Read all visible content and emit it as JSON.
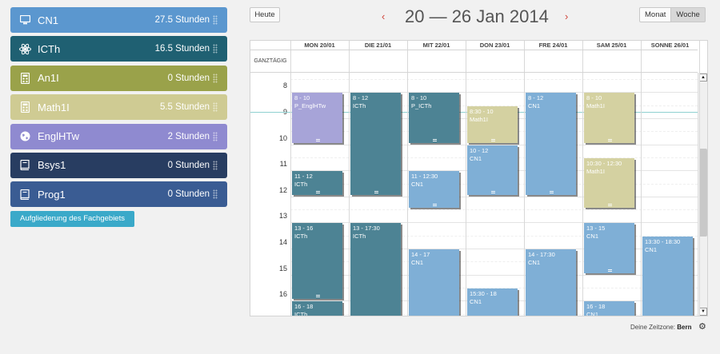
{
  "subjects": [
    {
      "name": "CN1",
      "hours": "27.5 Stunden",
      "color": "#5b97cf",
      "icon": "monitor-icon"
    },
    {
      "name": "ICTh",
      "hours": "16.5 Stunden",
      "color": "#1f6072",
      "icon": "atom-icon"
    },
    {
      "name": "An1I",
      "hours": "0 Stunden",
      "color": "#9aa24a",
      "icon": "calculator-icon"
    },
    {
      "name": "Math1I",
      "hours": "5.5 Stunden",
      "color": "#cfcb93",
      "icon": "calculator-icon"
    },
    {
      "name": "EnglHTw",
      "hours": "2 Stunden",
      "color": "#8f8ad0",
      "icon": "globe-icon"
    },
    {
      "name": "Bsys1",
      "hours": "0 Stunden",
      "color": "#283d61",
      "icon": "book-icon"
    },
    {
      "name": "Prog1",
      "hours": "0 Stunden",
      "color": "#3a5c93",
      "icon": "book-icon"
    }
  ],
  "breakdown_button": "Aufgliederung des Fachgebiets",
  "header": {
    "today": "Heute",
    "prev": "‹",
    "next": "›",
    "title": "20 — 26 Jan 2014",
    "views": [
      "Monat",
      "Woche"
    ],
    "active_view": "Woche"
  },
  "calendar": {
    "days": [
      "MON 20/01",
      "DIE 21/01",
      "MIT 22/01",
      "DON 23/01",
      "FRE 24/01",
      "SAM 25/01",
      "SONNE 26/01"
    ],
    "allday_label": "GANZTÄGIG",
    "hours": [
      "8",
      "9",
      "10",
      "11",
      "12",
      "13",
      "14",
      "15",
      "16"
    ],
    "now_hour": 8.75,
    "events": [
      {
        "day": 0,
        "start": 8,
        "end": 10,
        "time": "8 - 10",
        "title": "P_EnglHTw",
        "color": "purple"
      },
      {
        "day": 0,
        "start": 11,
        "end": 12,
        "time": "11 - 12",
        "title": "ICTh",
        "color": "teal"
      },
      {
        "day": 0,
        "start": 13,
        "end": 16,
        "time": "13 - 16",
        "title": "ICTh",
        "color": "teal"
      },
      {
        "day": 0,
        "start": 16,
        "end": 18,
        "time": "16 - 18",
        "title": "ICTh",
        "color": "teal"
      },
      {
        "day": 1,
        "start": 8,
        "end": 12,
        "time": "8 - 12",
        "title": "ICTh",
        "color": "teal"
      },
      {
        "day": 1,
        "start": 13,
        "end": 17.5,
        "time": "13 - 17:30",
        "title": "ICTh",
        "color": "teal"
      },
      {
        "day": 2,
        "start": 8,
        "end": 10,
        "time": "8 - 10",
        "title": "P_ICTh",
        "color": "teal"
      },
      {
        "day": 2,
        "start": 11,
        "end": 12.5,
        "time": "11 - 12:30",
        "title": "CN1",
        "color": "blue"
      },
      {
        "day": 2,
        "start": 14,
        "end": 17,
        "time": "14 - 17",
        "title": "CN1",
        "color": "blue"
      },
      {
        "day": 3,
        "start": 8.5,
        "end": 10,
        "time": "8:30 - 10",
        "title": "Math1I",
        "color": "khaki"
      },
      {
        "day": 3,
        "start": 10,
        "end": 12,
        "time": "10 - 12",
        "title": "CN1",
        "color": "blue"
      },
      {
        "day": 3,
        "start": 15.5,
        "end": 18,
        "time": "15:30 - 18",
        "title": "CN1",
        "color": "blue"
      },
      {
        "day": 4,
        "start": 8,
        "end": 12,
        "time": "8 - 12",
        "title": "CN1",
        "color": "blue"
      },
      {
        "day": 4,
        "start": 14,
        "end": 17.5,
        "time": "14 - 17:30",
        "title": "CN1",
        "color": "blue"
      },
      {
        "day": 5,
        "start": 8,
        "end": 10,
        "time": "8 - 10",
        "title": "Math1I",
        "color": "khaki"
      },
      {
        "day": 5,
        "start": 10.5,
        "end": 12.5,
        "time": "10:30 - 12:30",
        "title": "Math1I",
        "color": "khaki"
      },
      {
        "day": 5,
        "start": 13,
        "end": 15,
        "time": "13 - 15",
        "title": "CN1",
        "color": "blue"
      },
      {
        "day": 5,
        "start": 16,
        "end": 18,
        "time": "16 - 18",
        "title": "CN1",
        "color": "blue"
      },
      {
        "day": 6,
        "start": 13.5,
        "end": 18.5,
        "time": "13:30 - 18:30",
        "title": "CN1",
        "color": "blue"
      }
    ]
  },
  "timezone": {
    "label": "Deine Zeitzone:",
    "value": "Bern"
  }
}
